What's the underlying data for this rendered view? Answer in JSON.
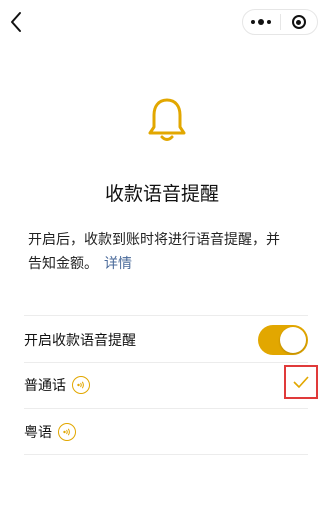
{
  "header": {
    "back_icon": "chevron-left-icon",
    "menu_icon": "more-dots-icon",
    "close_icon": "target-icon"
  },
  "main": {
    "bell_icon": "bell-icon",
    "title": "收款语音提醒",
    "description_line1": "开启后，收款到账时将进行语音提醒，并",
    "description_line2": "告知金额。",
    "details_link": "详情"
  },
  "settings": {
    "enable_label": "开启收款语音提醒",
    "enable_on": true,
    "options": [
      {
        "label": "普通话",
        "selected": true,
        "icon": "sound-icon"
      },
      {
        "label": "粤语",
        "selected": false,
        "icon": "sound-icon"
      }
    ],
    "selected_icon": "checkmark-icon"
  },
  "colors": {
    "accent": "#e2a700",
    "highlight_box": "#e03a3a",
    "link": "#4a6a9a"
  }
}
